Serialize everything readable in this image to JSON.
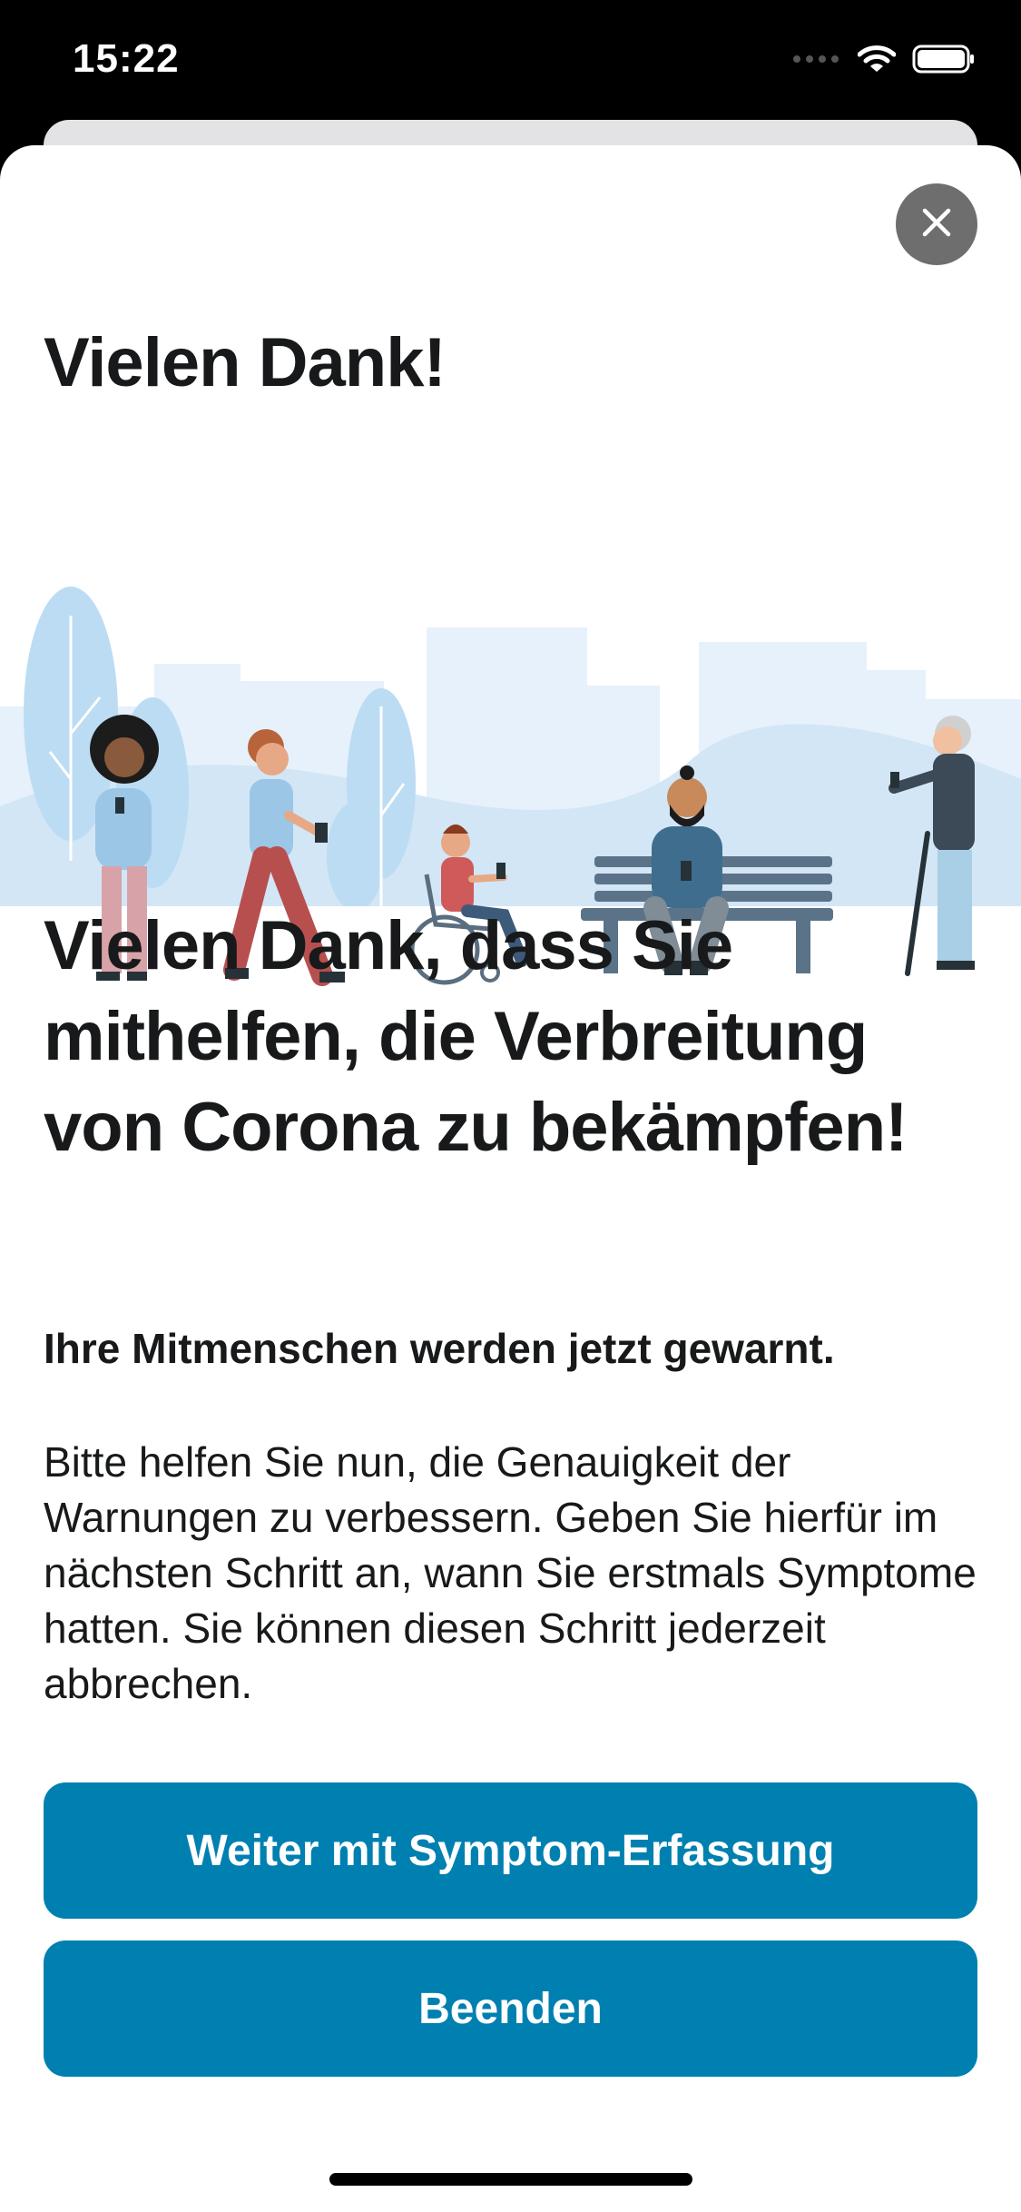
{
  "status_bar": {
    "time": "15:22"
  },
  "sheet": {
    "title_small": "Vielen Dank!",
    "headline": "Vielen Dank, dass Sie mithelfen, die Verbreitung von Corona zu bekämpfen!",
    "subtitle": "Ihre Mitmenschen werden jetzt gewarnt.",
    "body": "Bitte helfen Sie nun, die Genauigkeit der Warnungen zu verbessern. Geben Sie hierfür im nächsten Schritt an, wann Sie erstmals Symptome hatten. Sie können diesen Schritt jederzeit abbrechen.",
    "primary_button": "Weiter mit Symptom-Erfassung",
    "secondary_button": "Beenden"
  },
  "colors": {
    "accent": "#0080b0",
    "text": "#17191a",
    "close_button": "#6e6e6e"
  }
}
